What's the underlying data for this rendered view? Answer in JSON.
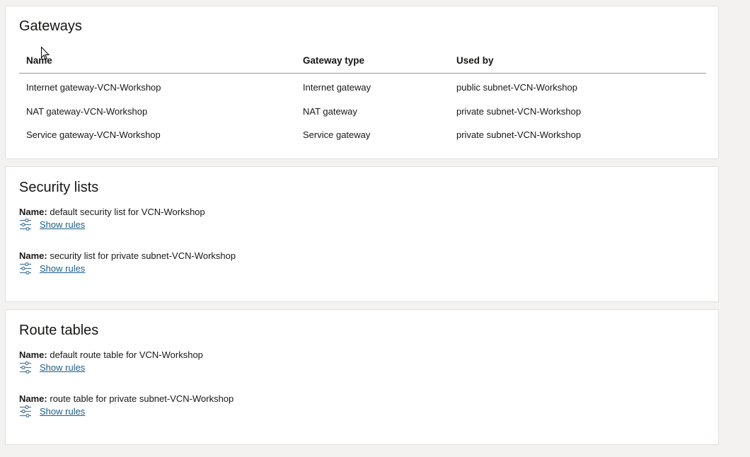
{
  "gateways": {
    "title": "Gateways",
    "columns": [
      "Name",
      "Gateway type",
      "Used by"
    ],
    "rows": [
      {
        "name": "Internet gateway-VCN-Workshop",
        "type": "Internet gateway",
        "used_by": "public subnet-VCN-Workshop"
      },
      {
        "name": "NAT gateway-VCN-Workshop",
        "type": "NAT gateway",
        "used_by": "private subnet-VCN-Workshop"
      },
      {
        "name": "Service gateway-VCN-Workshop",
        "type": "Service gateway",
        "used_by": "private subnet-VCN-Workshop"
      }
    ]
  },
  "security_lists": {
    "title": "Security lists",
    "name_label": "Name:",
    "items": [
      {
        "name": "default security list for VCN-Workshop",
        "link": "Show rules"
      },
      {
        "name": "security list for private subnet-VCN-Workshop",
        "link": "Show rules"
      }
    ]
  },
  "route_tables": {
    "title": "Route tables",
    "name_label": "Name:",
    "items": [
      {
        "name": "default route table for VCN-Workshop",
        "link": "Show rules"
      },
      {
        "name": "route table for private subnet-VCN-Workshop",
        "link": "Show rules"
      }
    ]
  },
  "icons": {
    "show_rules": "sliders-icon",
    "cursor": "mouse-pointer-icon"
  },
  "colors": {
    "link": "#1b5e8a",
    "icon": "#4a7a9c",
    "background": "#f3f2f1",
    "card": "#ffffff"
  }
}
